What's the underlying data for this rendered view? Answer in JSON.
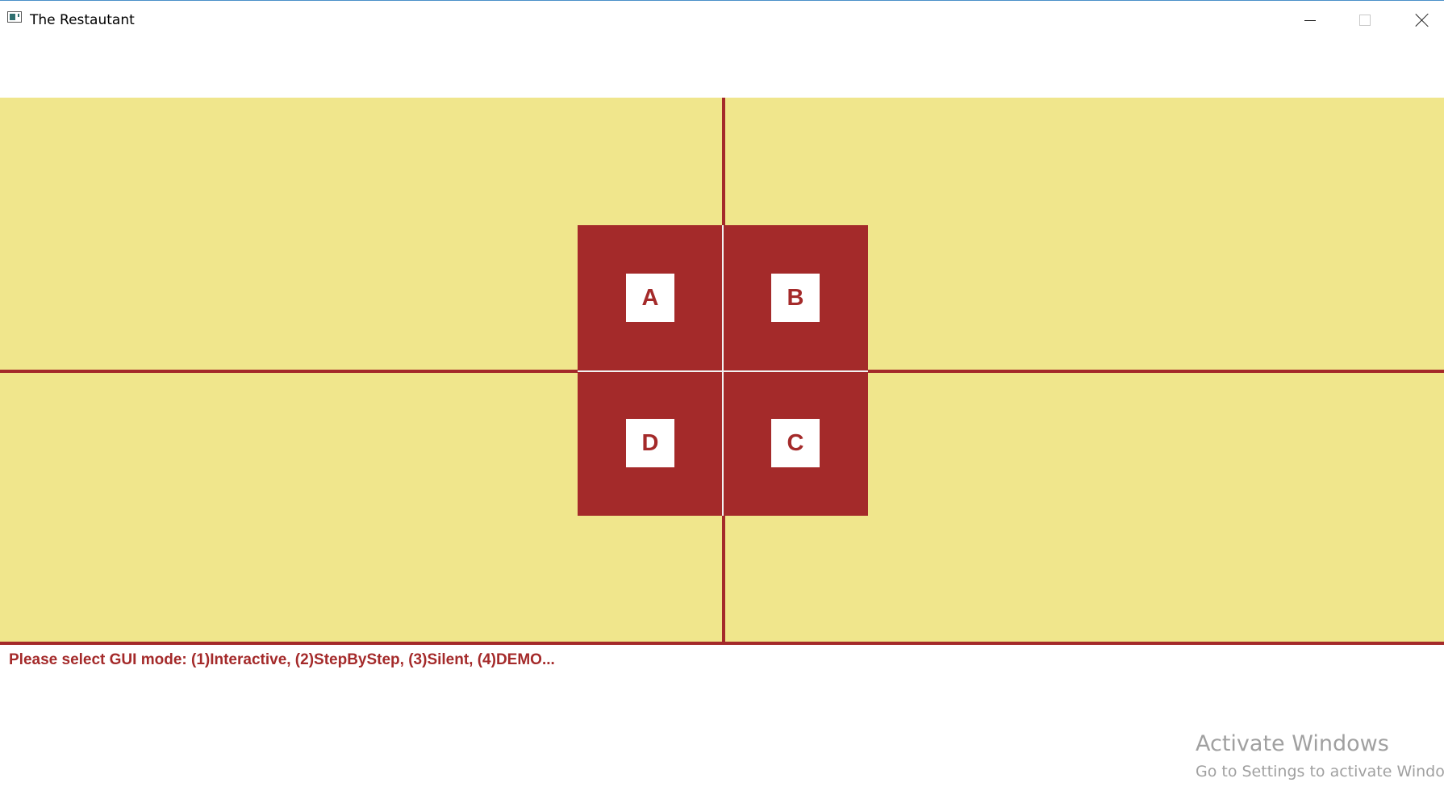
{
  "window": {
    "title": "The Restautant",
    "controls": [
      "minimize",
      "maximize",
      "close"
    ]
  },
  "colors": {
    "floor": "#f0e68c",
    "accent": "#a42a2a",
    "table_label_bg": "#ffffff"
  },
  "tables": [
    {
      "label": "A"
    },
    {
      "label": "B"
    },
    {
      "label": "D"
    },
    {
      "label": "C"
    }
  ],
  "status": {
    "message": "Please select GUI mode: (1)Interactive, (2)StepByStep, (3)Silent, (4)DEMO..."
  },
  "watermark": {
    "title": "Activate Windows",
    "subtitle": "Go to Settings to activate Windo"
  }
}
